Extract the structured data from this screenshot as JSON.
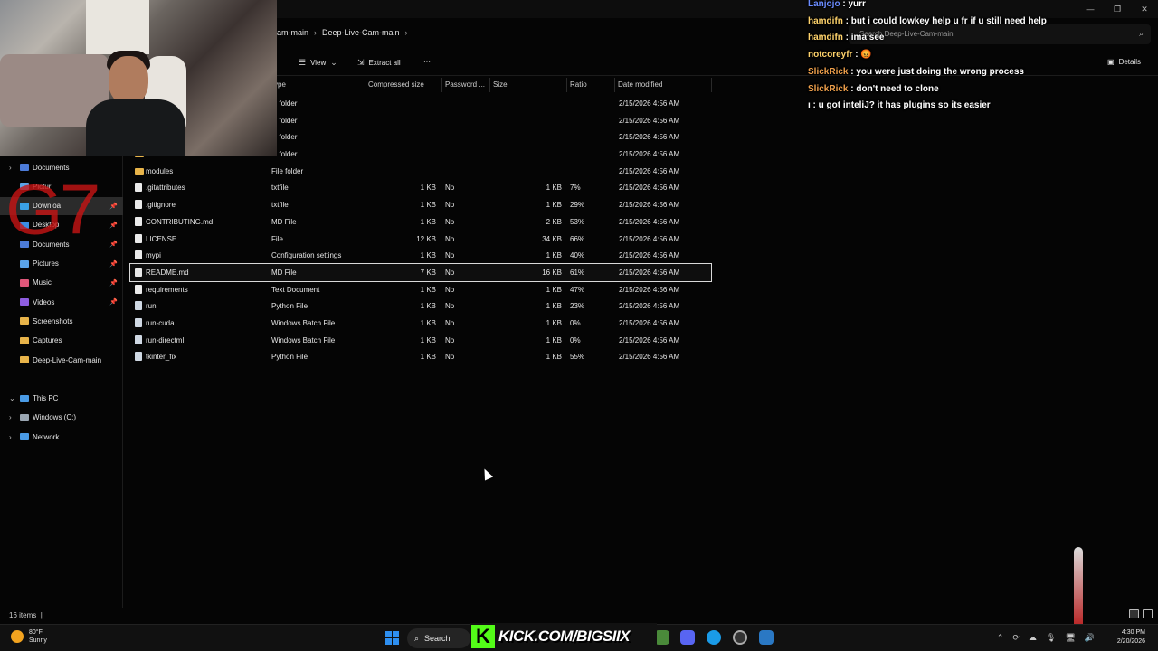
{
  "breadcrumb": [
    "am-main",
    "Deep-Live-Cam-main"
  ],
  "search": {
    "placeholder": "Search Deep-Live-Cam-main"
  },
  "toolbar": {
    "view": "View",
    "extract_all": "Extract all",
    "more": "···",
    "details": "Details"
  },
  "columns": [
    "ype",
    "Compressed size",
    "Password ...",
    "Size",
    "Ratio",
    "Date modified"
  ],
  "rows": [
    {
      "name": "",
      "type": "le folder",
      "compressed": "",
      "password": "",
      "size": "",
      "ratio": "",
      "date": "2/15/2026 4:56 AM",
      "icon": "folder"
    },
    {
      "name": "",
      "type": "le folder",
      "compressed": "",
      "password": "",
      "size": "",
      "ratio": "",
      "date": "2/15/2026 4:56 AM",
      "icon": "folder"
    },
    {
      "name": "",
      "type": "le folder",
      "compressed": "",
      "password": "",
      "size": "",
      "ratio": "",
      "date": "2/15/2026 4:56 AM",
      "icon": "folder"
    },
    {
      "name": "",
      "type": "le folder",
      "compressed": "",
      "password": "",
      "size": "",
      "ratio": "",
      "date": "2/15/2026 4:56 AM",
      "icon": "folder"
    },
    {
      "name": "modules",
      "type": "File folder",
      "compressed": "",
      "password": "",
      "size": "",
      "ratio": "",
      "date": "2/15/2026 4:56 AM",
      "icon": "folder"
    },
    {
      "name": ".gitattributes",
      "type": "txtfile",
      "compressed": "1 KB",
      "password": "No",
      "size": "1 KB",
      "ratio": "7%",
      "date": "2/15/2026 4:56 AM",
      "icon": "file"
    },
    {
      "name": ".gitignore",
      "type": "txtfile",
      "compressed": "1 KB",
      "password": "No",
      "size": "1 KB",
      "ratio": "29%",
      "date": "2/15/2026 4:56 AM",
      "icon": "file"
    },
    {
      "name": "CONTRIBUTING.md",
      "type": "MD File",
      "compressed": "1 KB",
      "password": "No",
      "size": "2 KB",
      "ratio": "53%",
      "date": "2/15/2026 4:56 AM",
      "icon": "file"
    },
    {
      "name": "LICENSE",
      "type": "File",
      "compressed": "12 KB",
      "password": "No",
      "size": "34 KB",
      "ratio": "66%",
      "date": "2/15/2026 4:56 AM",
      "icon": "file"
    },
    {
      "name": "mypi",
      "type": "Configuration settings",
      "compressed": "1 KB",
      "password": "No",
      "size": "1 KB",
      "ratio": "40%",
      "date": "2/15/2026 4:56 AM",
      "icon": "file"
    },
    {
      "name": "README.md",
      "type": "MD File",
      "compressed": "7 KB",
      "password": "No",
      "size": "16 KB",
      "ratio": "61%",
      "date": "2/15/2026 4:56 AM",
      "icon": "file",
      "selected": true
    },
    {
      "name": "requirements",
      "type": "Text Document",
      "compressed": "1 KB",
      "password": "No",
      "size": "1 KB",
      "ratio": "47%",
      "date": "2/15/2026 4:56 AM",
      "icon": "file"
    },
    {
      "name": "run",
      "type": "Python File",
      "compressed": "1 KB",
      "password": "No",
      "size": "1 KB",
      "ratio": "23%",
      "date": "2/15/2026 4:56 AM",
      "icon": "script"
    },
    {
      "name": "run-cuda",
      "type": "Windows Batch File",
      "compressed": "1 KB",
      "password": "No",
      "size": "1 KB",
      "ratio": "0%",
      "date": "2/15/2026 4:56 AM",
      "icon": "script"
    },
    {
      "name": "run-directml",
      "type": "Windows Batch File",
      "compressed": "1 KB",
      "password": "No",
      "size": "1 KB",
      "ratio": "0%",
      "date": "2/15/2026 4:56 AM",
      "icon": "script"
    },
    {
      "name": "tkinter_fix",
      "type": "Python File",
      "compressed": "1 KB",
      "password": "No",
      "size": "1 KB",
      "ratio": "55%",
      "date": "2/15/2026 4:56 AM",
      "icon": "script"
    }
  ],
  "nav": [
    {
      "label": "Documents",
      "chev": "›",
      "color": "#4c7bd8",
      "pin": ""
    },
    {
      "label": "Pictur",
      "chev": "",
      "color": "#5aa3e8",
      "pin": ""
    },
    {
      "label": "Downloa",
      "chev": "",
      "color": "#3aa0e6",
      "pin": "📌",
      "active": true
    },
    {
      "label": "Desktop",
      "chev": "",
      "color": "#3a8de6",
      "pin": "📌"
    },
    {
      "label": "Documents",
      "chev": "",
      "color": "#4c7bd8",
      "pin": "📌"
    },
    {
      "label": "Pictures",
      "chev": "",
      "color": "#5aa3e8",
      "pin": "📌"
    },
    {
      "label": "Music",
      "chev": "",
      "color": "#e0577a",
      "pin": "📌"
    },
    {
      "label": "Videos",
      "chev": "",
      "color": "#8e5de0",
      "pin": "📌"
    },
    {
      "label": "Screenshots",
      "chev": "",
      "color": "#e8b44a",
      "pin": ""
    },
    {
      "label": "Captures",
      "chev": "",
      "color": "#e8b44a",
      "pin": ""
    },
    {
      "label": "Deep-Live-Cam-main",
      "chev": "",
      "color": "#e8b44a",
      "pin": ""
    },
    {
      "label": "",
      "chev": "",
      "color": "transparent",
      "pin": ""
    },
    {
      "label": "This PC",
      "chev": "⌄",
      "color": "#4a9be6",
      "pin": ""
    },
    {
      "label": "Windows (C:)",
      "chev": "›",
      "color": "#9aa6b2",
      "pin": ""
    },
    {
      "label": "Network",
      "chev": "›",
      "color": "#4a9be6",
      "pin": ""
    }
  ],
  "chat": [
    {
      "user": "Lanjojo",
      "color": "#6b8cff",
      "msg": " : yurr"
    },
    {
      "user": "hamdifn",
      "color": "#ffd36b",
      "msg": " : but i could lowkey help u fr if u still need help"
    },
    {
      "user": "hamdifn",
      "color": "#ffd36b",
      "msg": " : ima see"
    },
    {
      "user": "notcoreyfr",
      "color": "#ffd36b",
      "msg": " : 😡"
    },
    {
      "user": "SlickRick",
      "color": "#f0a04b",
      "msg": " : you were just doing the wrong process"
    },
    {
      "user": "SlickRick",
      "color": "#f0a04b",
      "msg": " : don't need to clone"
    },
    {
      "user": "",
      "color": "#fff",
      "msg": "ı : u got inteliJ? it has plugins so its easier"
    }
  ],
  "overlay": {
    "g7": "G7"
  },
  "status": {
    "items": "16 items",
    "sep": "|"
  },
  "taskbar": {
    "temp": "80°F",
    "weather": "Sunny",
    "search": "Search",
    "kick_url": "KICK.COM/BIGSIIX",
    "time": "4:30 PM",
    "date": "2/20/2026"
  }
}
